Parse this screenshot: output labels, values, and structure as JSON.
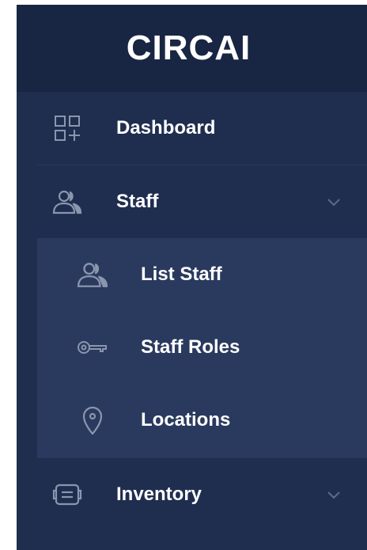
{
  "brand": {
    "name": "CIRCAI"
  },
  "colors": {
    "sidebar_bg": "#1f2e4f",
    "brand_bg": "#182543",
    "submenu_bg": "#2a3a5e",
    "icon_color": "#8b96ad",
    "text_color": "#ffffff"
  },
  "nav": {
    "items": [
      {
        "label": "Dashboard",
        "icon": "dashboard-grid-icon",
        "expandable": false
      },
      {
        "label": "Staff",
        "icon": "users-icon",
        "expandable": true,
        "expanded": true,
        "children": [
          {
            "label": "List Staff",
            "icon": "users-icon"
          },
          {
            "label": "Staff Roles",
            "icon": "key-icon"
          },
          {
            "label": "Locations",
            "icon": "map-pin-icon"
          }
        ]
      },
      {
        "label": "Inventory",
        "icon": "inventory-box-icon",
        "expandable": true,
        "expanded": false
      }
    ]
  }
}
